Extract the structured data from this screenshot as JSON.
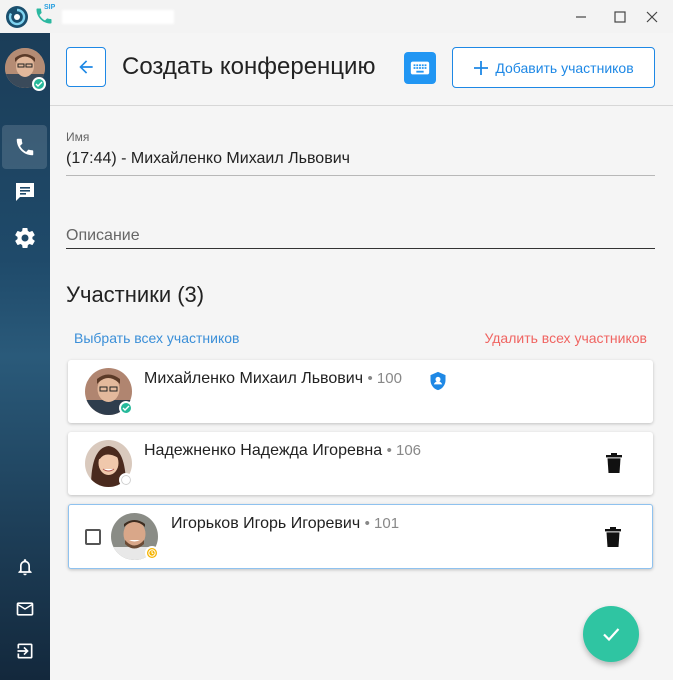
{
  "header": {
    "title": "Создать конференцию",
    "add_participants_label": "Добавить участников"
  },
  "form": {
    "name_label": "Имя",
    "name_value": "(17:44) - Михайленко Михаил Львович",
    "description_placeholder": "Описание"
  },
  "participants": {
    "title": "Участники (3)",
    "select_all_label": "Выбрать всех участников",
    "delete_all_label": "Удалить всех участников",
    "list": [
      {
        "name": "Михайленко Михаил Львович",
        "ext": "• 100",
        "status": "online"
      },
      {
        "name": "Надежненко Надежда Игоревна",
        "ext": "• 106",
        "status": "offline"
      },
      {
        "name": "Игорьков Игорь Игоревич",
        "ext": "• 101",
        "status": "away"
      }
    ]
  },
  "colors": {
    "accent": "#1e88e5",
    "online": "#26b99a",
    "away": "#f5b400",
    "danger": "#f06461",
    "fab": "#2fc5a2"
  }
}
